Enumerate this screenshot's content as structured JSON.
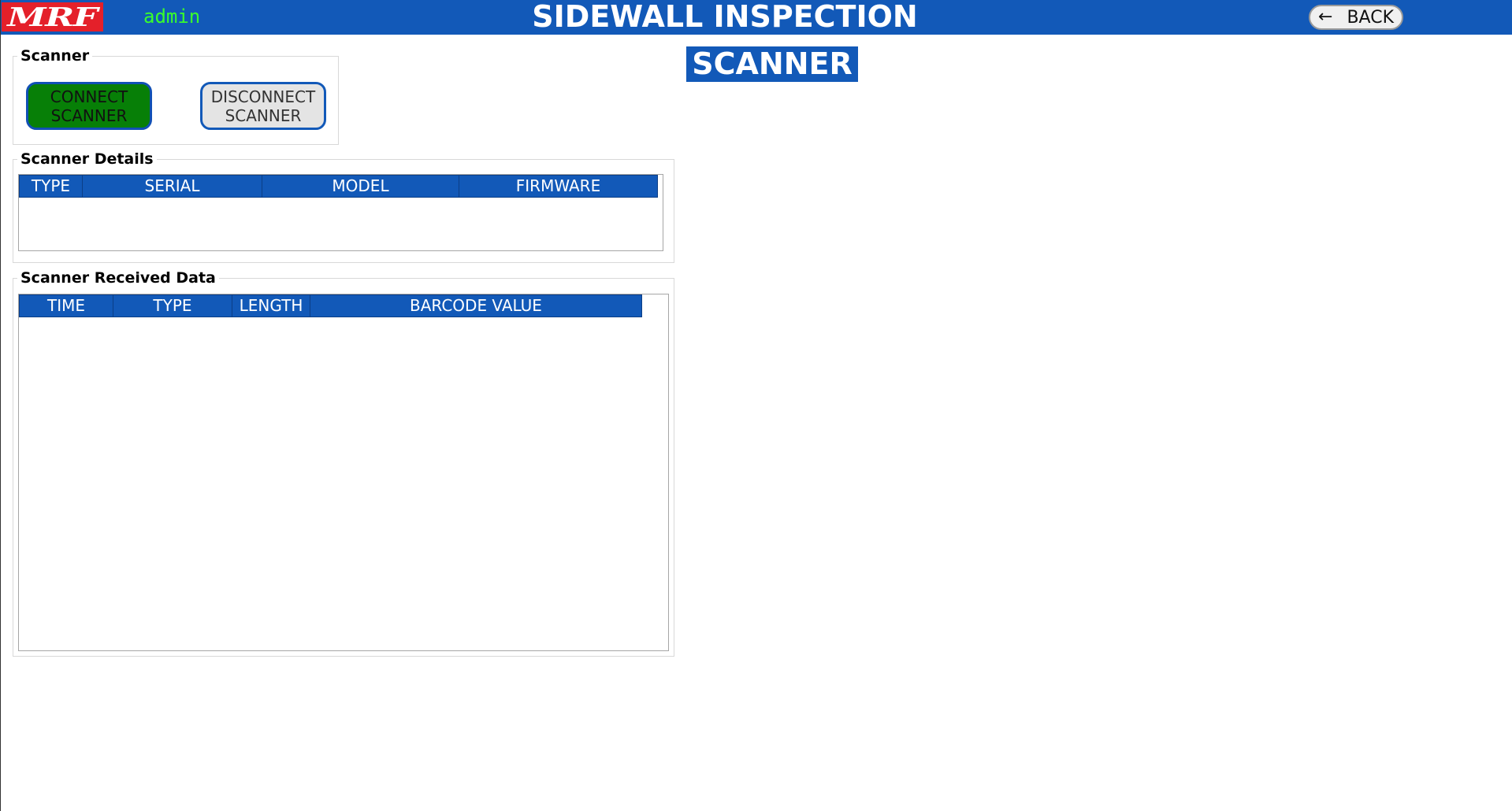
{
  "header": {
    "logo_text": "MRF",
    "username": "admin",
    "title": "SIDEWALL INSPECTION",
    "back_label": "BACK",
    "back_icon": "arrow-left-icon",
    "colors": {
      "bar": "#1259b8",
      "logo": "#e4202a",
      "username": "#39ff2b"
    }
  },
  "page_title": "SCANNER",
  "scanner_group": {
    "legend": "Scanner",
    "connect_label": "CONNECT\nSCANNER",
    "disconnect_label": "DISCONNECT\nSCANNER",
    "connect_color": "#077f07"
  },
  "details_group": {
    "legend": "Scanner Details",
    "columns": [
      "TYPE",
      "SERIAL",
      "MODEL",
      "FIRMWARE"
    ],
    "rows": []
  },
  "received_group": {
    "legend": "Scanner Received Data",
    "columns": [
      "TIME",
      "TYPE",
      "LENGTH",
      "BARCODE VALUE"
    ],
    "rows": []
  }
}
